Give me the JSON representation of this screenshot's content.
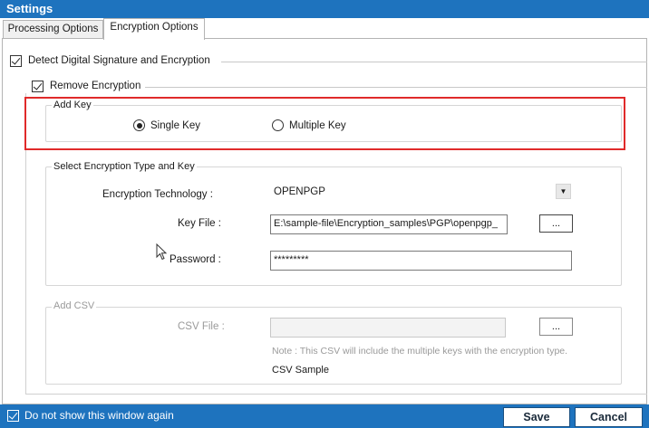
{
  "window": {
    "title": "Settings"
  },
  "tabs": [
    {
      "label": "Processing Options",
      "active": false
    },
    {
      "label": "Encryption Options",
      "active": true
    }
  ],
  "detect_signature": {
    "label": "Detect Digital Signature and Encryption",
    "checked": true
  },
  "remove_encryption": {
    "label": "Remove Encryption",
    "checked": true
  },
  "add_key": {
    "title": "Add Key",
    "options": [
      {
        "label": "Single Key",
        "selected": true
      },
      {
        "label": "Multiple Key",
        "selected": false
      }
    ]
  },
  "encryption_type": {
    "title": "Select Encryption Type and Key",
    "technology_label": "Encryption Technology :",
    "technology_value": "OPENPGP",
    "key_file_label": "Key File  :",
    "key_file_value": "E:\\sample-file\\Encryption_samples\\PGP\\openpgp_",
    "browse_label": "...",
    "password_label": "Password :",
    "password_value": "*********"
  },
  "add_csv": {
    "title": "Add CSV",
    "csv_file_label": "CSV File :",
    "csv_file_value": "",
    "browse_label": "...",
    "note": "Note : This CSV will include the multiple keys with the encryption type.",
    "sample_link": "CSV Sample"
  },
  "footer": {
    "dont_show_label": "Do not show this window again",
    "dont_show_checked": true,
    "save_label": "Save",
    "cancel_label": "Cancel"
  },
  "colors": {
    "accent": "#1e73be",
    "highlight": "#e02a2a"
  },
  "icons": {
    "cursor": "mouse-pointer-icon",
    "dropdown": "dropdown-arrow-icon"
  }
}
